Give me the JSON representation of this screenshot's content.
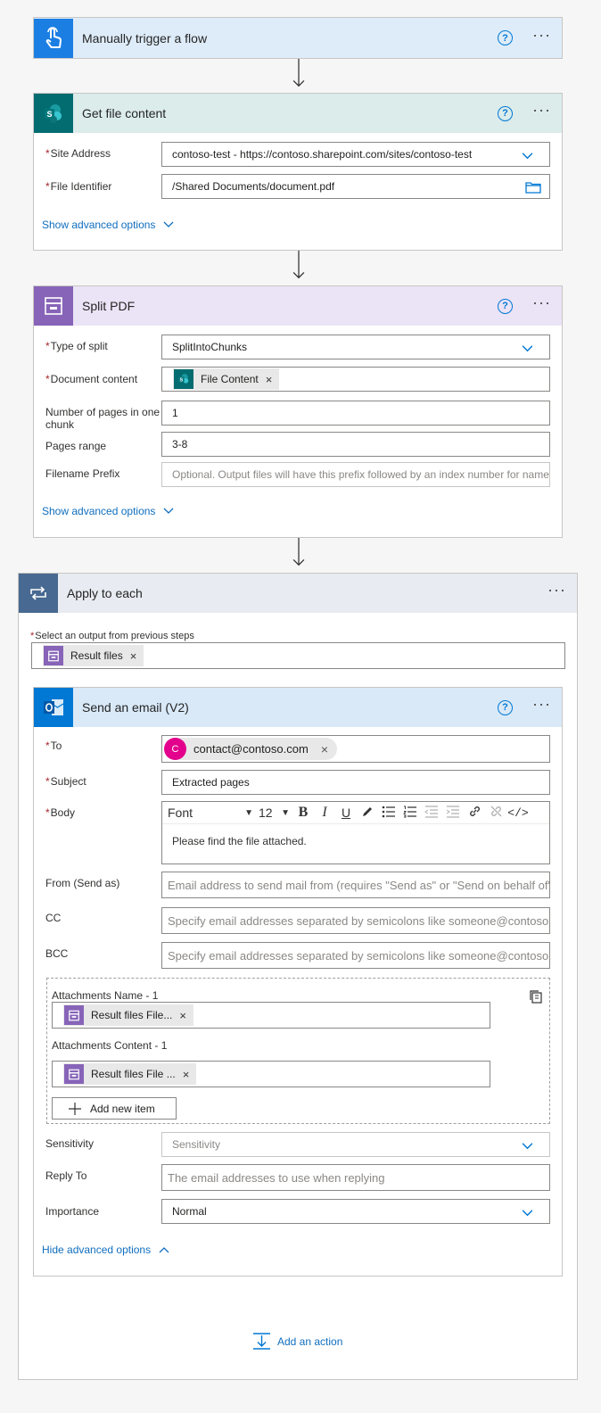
{
  "trigger": {
    "title": "Manually trigger a flow",
    "help": "?",
    "more": "···"
  },
  "get_file": {
    "title": "Get file content",
    "help": "?",
    "more": "···",
    "site_label": "Site Address",
    "site_value": "contoso-test - https://contoso.sharepoint.com/sites/contoso-test",
    "file_label": "File Identifier",
    "file_value": "/Shared Documents/document.pdf",
    "advanced": "Show advanced options"
  },
  "split_pdf": {
    "title": "Split PDF",
    "help": "?",
    "more": "···",
    "type_label": "Type of split",
    "type_value": "SplitIntoChunks",
    "doc_label": "Document content",
    "doc_token": "File Content",
    "token_x": "×",
    "pages_label": "Number of pages in one chunk",
    "pages_value": "1",
    "range_label": "Pages range",
    "range_value": "3-8",
    "prefix_label": "Filename Prefix",
    "prefix_placeholder": "Optional. Output files will have this prefix followed by an index number for name",
    "advanced": "Show advanced options"
  },
  "apply_each": {
    "title": "Apply to each",
    "more": "···",
    "select_label": "Select an output from previous steps",
    "select_token": "Result files",
    "token_x": "×"
  },
  "send_email": {
    "title": "Send an email (V2)",
    "help": "?",
    "more": "···",
    "to_label": "To",
    "to_avatar": "C",
    "to_value": "contact@contoso.com",
    "to_x": "×",
    "subject_label": "Subject",
    "subject_value": "Extracted pages",
    "body_label": "Body",
    "font": "Font",
    "font_size": "12",
    "toolbar": {
      "bold": "B",
      "italic": "I",
      "underline": "U",
      "code": "</>"
    },
    "body_value": "Please find the file attached.",
    "from_label": "From (Send as)",
    "from_placeholder": "Email address to send mail from (requires \"Send as\" or \"Send on behalf of\" permission)",
    "cc_label": "CC",
    "cc_placeholder": "Specify email addresses separated by semicolons like someone@contoso.com",
    "bcc_label": "BCC",
    "bcc_placeholder": "Specify email addresses separated by semicolons like someone@contoso.com",
    "att_name_label": "Attachments Name - 1",
    "att_name_token": "Result files File...",
    "att_content_label": "Attachments Content - 1",
    "att_content_token": "Result files File ...",
    "token_x": "×",
    "add_item": "Add new item",
    "sensitivity_label": "Sensitivity",
    "sensitivity_placeholder": "Sensitivity",
    "reply_label": "Reply To",
    "reply_placeholder": "The email addresses to use when replying",
    "importance_label": "Importance",
    "importance_value": "Normal",
    "advanced": "Hide advanced options"
  },
  "add_action": "Add an action",
  "colors": {
    "trigger": "#0078d4",
    "sharepoint": "#036c70",
    "pdf": "#8764b8",
    "loop": "#486991",
    "outlook": "#0078d4",
    "link": "#106ebe",
    "required": "#a4262c"
  }
}
